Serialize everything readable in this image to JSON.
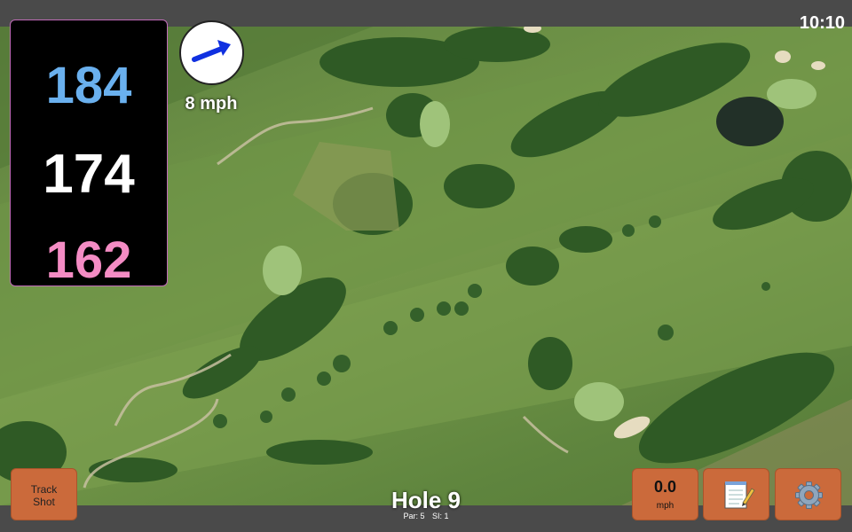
{
  "status_bar": {
    "time": "10:10"
  },
  "distances": {
    "back": "184",
    "middle": "174",
    "front": "162"
  },
  "wind": {
    "speed_label": "8 mph",
    "direction_icon": "arrow-icon"
  },
  "buttons": {
    "track_shot_line1": "Track",
    "track_shot_line2": "Shot",
    "speed_value": "0.0",
    "speed_unit": "mph",
    "notes_icon": "notepad-icon",
    "settings_icon": "gear-icon"
  },
  "hole": {
    "title": "Hole 9",
    "par_label": "Par: 5",
    "si_label": "SI: 1"
  },
  "colors": {
    "back_distance": "#6ab0ee",
    "middle_distance": "#ffffff",
    "front_distance": "#f48cc4",
    "button": "#cb6a3b",
    "wind_arrow": "#1030e0"
  }
}
